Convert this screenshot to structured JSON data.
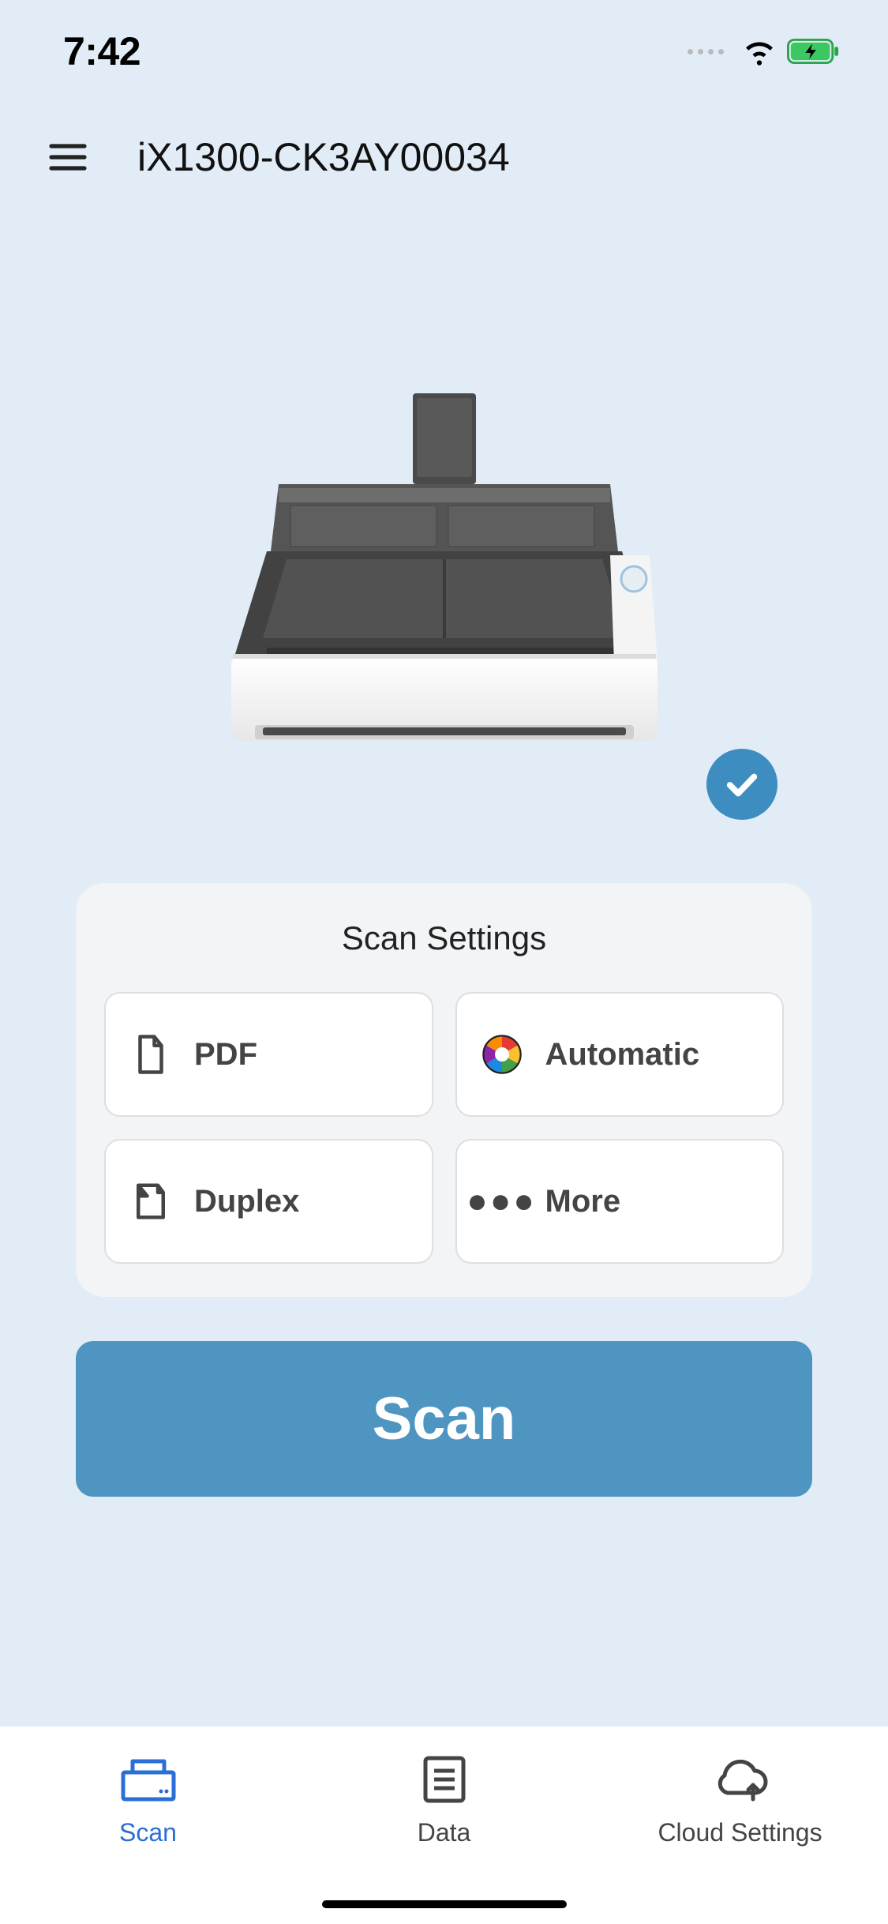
{
  "status_bar": {
    "time": "7:42"
  },
  "header": {
    "device_name": "iX1300-CK3AY00034"
  },
  "scanner": {
    "status_icon": "checkmark-icon"
  },
  "settings": {
    "title": "Scan Settings",
    "tiles": [
      {
        "icon": "file-icon",
        "label": "PDF"
      },
      {
        "icon": "color-wheel-icon",
        "label": "Automatic"
      },
      {
        "icon": "duplex-icon",
        "label": "Duplex"
      },
      {
        "icon": "more-icon",
        "label": "More"
      }
    ]
  },
  "scan_button": {
    "label": "Scan"
  },
  "tabs": [
    {
      "icon": "scan-tab-icon",
      "label": "Scan",
      "active": true
    },
    {
      "icon": "data-tab-icon",
      "label": "Data",
      "active": false
    },
    {
      "icon": "cloud-tab-icon",
      "label": "Cloud Settings",
      "active": false
    }
  ]
}
